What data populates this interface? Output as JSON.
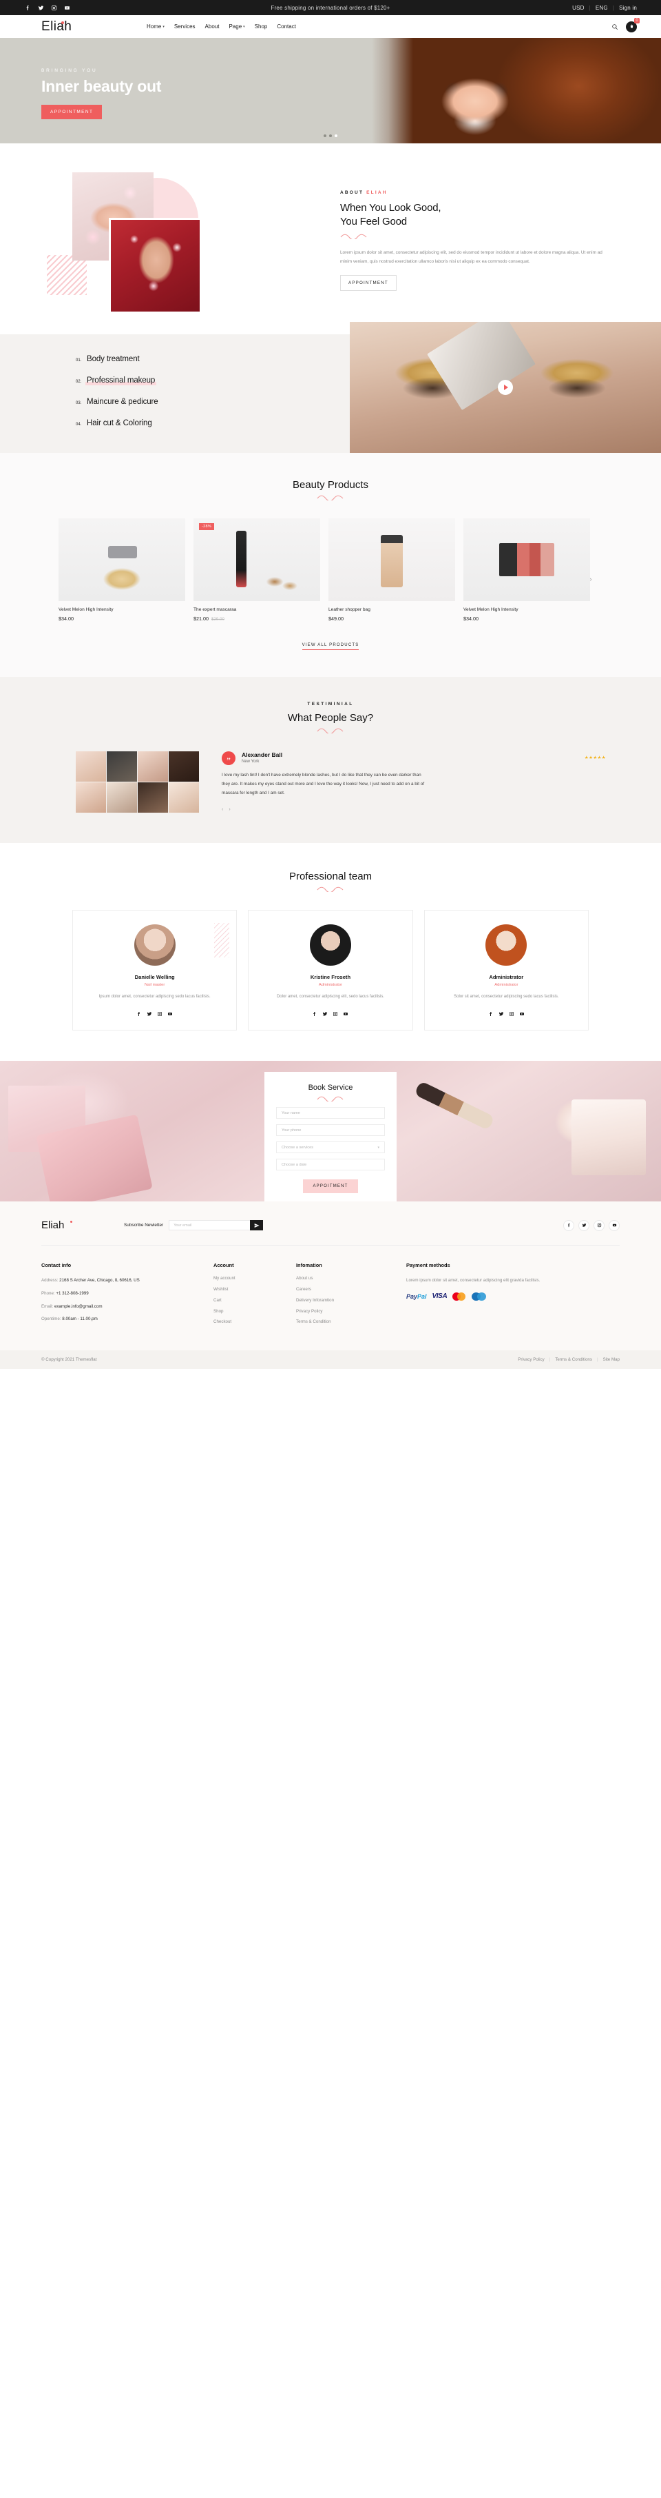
{
  "topbar": {
    "social": [
      "facebook-icon",
      "twitter-icon",
      "instagram-icon",
      "youtube-icon"
    ],
    "message": "Free shipping on international orders of $120+",
    "currency": "USD",
    "language": "ENG",
    "signin": "Sign in"
  },
  "header": {
    "logo": "Eliah",
    "nav": [
      {
        "label": "Home",
        "caret": "▾"
      },
      {
        "label": "Services",
        "caret": ""
      },
      {
        "label": "About",
        "caret": ""
      },
      {
        "label": "Page",
        "caret": "▾"
      },
      {
        "label": "Shop",
        "caret": ""
      },
      {
        "label": "Contact",
        "caret": ""
      }
    ],
    "cart_count": "0"
  },
  "hero": {
    "kicker": "BRINGING YOU",
    "title": "Inner beauty out",
    "cta": "APPOINTMENT",
    "slide_count": 3,
    "active_slide": 3
  },
  "about": {
    "eyebrow": "ABOUT",
    "eyebrow_accent": "ELIAH",
    "title": "When You Look Good,\nYou Feel Good",
    "title_line1": "When You Look Good,",
    "title_line2": "You Feel Good",
    "paragraph": "Lorem ipsum dolor sit amet, consectetur adipiscing elit, sed do eiusmod tempor incididunt ut labore et dolore magna aliqua. Ut enim ad minim veniam, quis nostrud exercitation ullamco laboris nisi ut aliquip ex ea commodo consequat.",
    "cta": "APPOINTMENT"
  },
  "services": {
    "items": [
      {
        "num": "01.",
        "name": "Body treatment",
        "highlighted": false
      },
      {
        "num": "02.",
        "name": "Professinal makeup",
        "highlighted": true
      },
      {
        "num": "03.",
        "name": "Maincure & pedicure",
        "highlighted": false
      },
      {
        "num": "04.",
        "name": "Hair cut & Coloring",
        "highlighted": false
      }
    ],
    "play_button": "play-icon"
  },
  "products": {
    "title": "Beauty Products",
    "view_all": "VIEW ALL PRODUCTS",
    "prev": "‹",
    "next": "›",
    "items": [
      {
        "name": "Velvet Melon High Intensity",
        "price": "$34.00",
        "old_price": "",
        "badge": ""
      },
      {
        "name": "The expert mascaraa",
        "price": "$21.00",
        "old_price": "$29.00",
        "badge": "-28%"
      },
      {
        "name": "Leather shopper bag",
        "price": "$49.00",
        "old_price": "",
        "badge": ""
      },
      {
        "name": "Velvet Melon High Intensity",
        "price": "$34.00",
        "old_price": "",
        "badge": ""
      }
    ]
  },
  "testimonial": {
    "eyebrow": "TESTIMINIAL",
    "title": "What People Say?",
    "name": "Alexander Ball",
    "location": "New York",
    "stars": "★★★★★",
    "rating": 5,
    "text": "I love my lash tint! I don't have extremely blonde lashes, but I do like that they can be even darker than they are. It makes my eyes stand out more and I love the way it looks! Now, I just need to add on a bit of mascara for length and I am set.",
    "prev": "‹",
    "next": "›"
  },
  "team": {
    "title": "Professional team",
    "members": [
      {
        "name": "Danielle Welling",
        "role": "Nail master",
        "desc": "Ipsum dolor amet, consectetur adipiscing sedo lacus facilisis."
      },
      {
        "name": "Kristine Froseth",
        "role": "Administrator",
        "desc": "Dolor amet, consectetur adipiscing elit, sedo lacus facilisis."
      },
      {
        "name": "Administrator",
        "role": "Administrator",
        "desc": "Solor sit amet, consectetur adipiscing sedo lacus facilisis."
      }
    ]
  },
  "booking": {
    "title": "Book Service",
    "name_placeholder": "Your name",
    "phone_placeholder": "Your phone",
    "service_placeholder": "Choose a services",
    "date_placeholder": "Choose a date",
    "cta": "APPOITMENT"
  },
  "footer": {
    "logo": "Eliah",
    "subscribe_label": "Subscribe Newletter",
    "email_placeholder": "Your email",
    "contact": {
      "title": "Contact info",
      "address_label": "Address:",
      "address_value": "2168 S Archer Ave, Chicago, IL 60616, US",
      "phone_label": "Phone:",
      "phone_value": "+1 312-808-1999",
      "email_label": "Email:",
      "email_value": "example.info@gmail.com",
      "opentime_label": "Opentime:",
      "opentime_value": "8.00am - 11.00.pm"
    },
    "account": {
      "title": "Account",
      "links": [
        "My account",
        "Wishlist",
        "Cart",
        "Shop",
        "Checkout"
      ]
    },
    "information": {
      "title": "Infomation",
      "links": [
        "About us",
        "Careers",
        "Delivery Inforamtion",
        "Privacy Policy",
        "Terms & Condition"
      ]
    },
    "payment": {
      "title": "Payment methods",
      "text": "Lorem ipsum dolor sit amet, consectetur adipiscing elit gravida facilisis.",
      "methods": [
        "PayPal",
        "VISA",
        "MasterCard",
        "Cirrus"
      ]
    },
    "copyright": "© Copyright 2021 Themesflat",
    "bottom_links": [
      "Privacy Policy",
      "Terms & Conditions",
      "Site Map"
    ]
  },
  "colors": {
    "accent": "#ef5e5e",
    "accent_soft": "#fbd3d3",
    "dark": "#1b1b1b",
    "light_bg": "#f4f2f0"
  }
}
